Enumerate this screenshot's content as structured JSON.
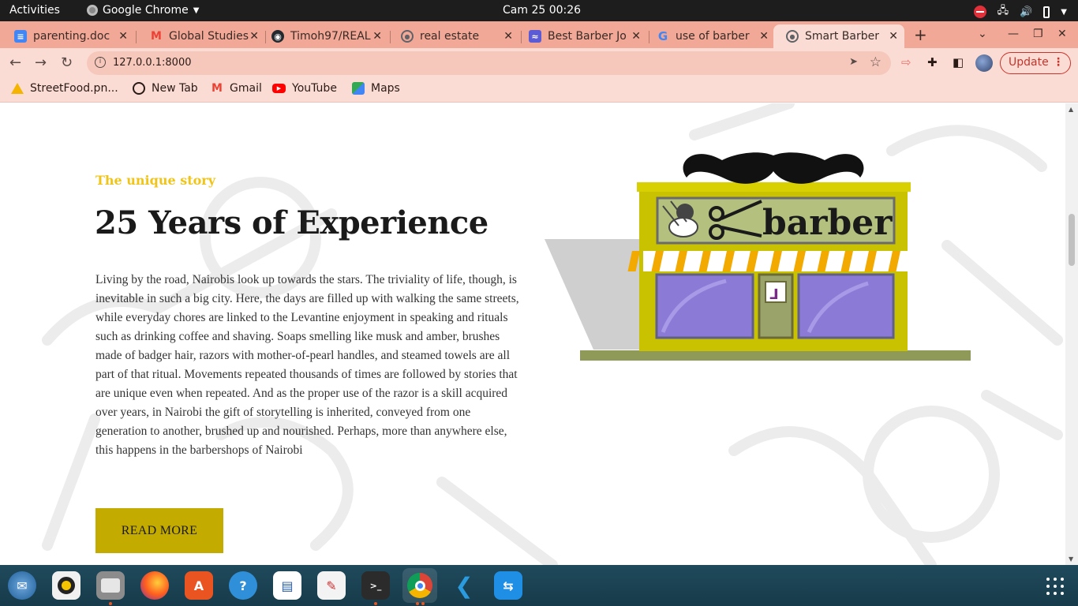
{
  "system_bar": {
    "activities": "Activities",
    "app_name": "Google Chrome",
    "clock": "Cam 25  00:26"
  },
  "browser": {
    "tabs": [
      {
        "title": "parenting.doc",
        "icon": "google-docs-icon",
        "color": "#4285f4"
      },
      {
        "title": "Global Studies",
        "icon": "gmail-icon",
        "color": "#ea4335"
      },
      {
        "title": "Timoh97/REAL",
        "icon": "github-icon",
        "color": "#24292e"
      },
      {
        "title": "real estate",
        "icon": "globe-icon",
        "color": "#5f6368"
      },
      {
        "title": "Best Barber Jo",
        "icon": "site-icon",
        "color": "#5b5bd6"
      },
      {
        "title": "use of barber",
        "icon": "google-icon",
        "color": "#4285f4"
      },
      {
        "title": "Smart Barber",
        "icon": "globe-icon",
        "color": "#5f6368",
        "active": true
      }
    ],
    "url": "127.0.0.1:8000",
    "update_label": "Update",
    "bookmarks": [
      {
        "label": "StreetFood.pn...",
        "icon": "google-drive-icon"
      },
      {
        "label": "New Tab",
        "icon": "globe-icon"
      },
      {
        "label": "Gmail",
        "icon": "gmail-icon"
      },
      {
        "label": "YouTube",
        "icon": "youtube-icon"
      },
      {
        "label": "Maps",
        "icon": "google-maps-icon"
      }
    ]
  },
  "page": {
    "eyebrow": "The unique story",
    "heading": "25 Years of Experience",
    "body": "Living by the road, Nairobis look up towards the stars. The triviality of life, though, is inevitable in such a big city. Here, the days are filled up with walking the same streets, while everyday chores are linked to the Levantine enjoyment in speaking and rituals such as drinking coffee and shaving. Soaps smelling like musk and amber, brushes made of badger hair, razors with mother-of-pearl handles, and steamed towels are all part of that ritual. Movements repeated thousands of times are followed by stories that are unique even when repeated. And as the proper use of the razor is a skill acquired over years, in Nairobi the gift of storytelling is inherited, conveyed from one generation to another, brushed up and nourished. Perhaps, more than anywhere else, this happens in the barbershops of Nairobi",
    "read_more": "READ MORE",
    "shop_sign": "barber",
    "accent_color": "#c4ab00",
    "eyebrow_color": "#f0c419"
  },
  "dock": {
    "apps": [
      "thunderbird-icon",
      "rhythmbox-icon",
      "files-icon",
      "firefox-icon",
      "app-center-icon",
      "help-icon",
      "libreoffice-writer-icon",
      "text-editor-icon",
      "terminal-icon",
      "chrome-icon",
      "vscode-icon",
      "teamviewer-icon"
    ]
  }
}
